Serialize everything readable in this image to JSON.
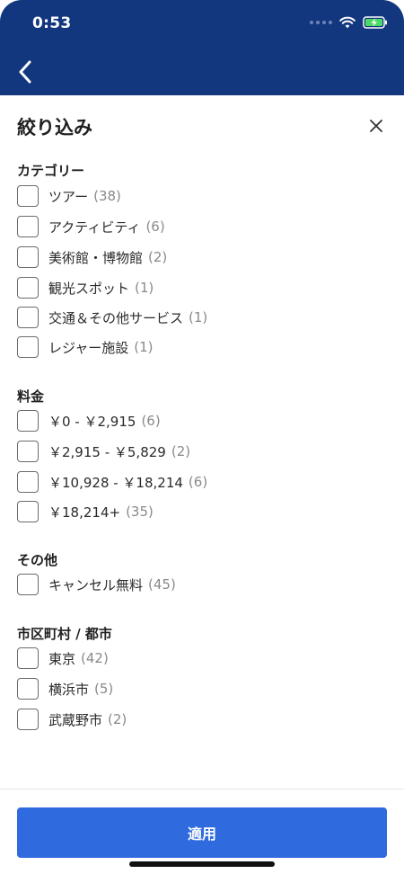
{
  "status_bar": {
    "time": "0:53"
  },
  "header": {
    "back_icon": "chevron-left-icon"
  },
  "panel": {
    "title": "絞り込み",
    "close_icon": "close-icon"
  },
  "sections": [
    {
      "title": "カテゴリー",
      "options": [
        {
          "label": "ツアー",
          "count": "(38)",
          "checked": false
        },
        {
          "label": "アクティビティ",
          "count": "(6)",
          "checked": false
        },
        {
          "label": "美術館・博物館",
          "count": "(2)",
          "checked": false
        },
        {
          "label": "観光スポット",
          "count": "(1)",
          "checked": false
        },
        {
          "label": "交通＆その他サービス",
          "count": "(1)",
          "checked": false
        },
        {
          "label": "レジャー施設",
          "count": "(1)",
          "checked": false
        }
      ]
    },
    {
      "title": "料金",
      "options": [
        {
          "label": "￥0 - ￥2,915",
          "count": "(6)",
          "checked": false
        },
        {
          "label": "￥2,915 - ￥5,829",
          "count": "(2)",
          "checked": false
        },
        {
          "label": "￥10,928 - ￥18,214",
          "count": "(6)",
          "checked": false
        },
        {
          "label": "￥18,214+",
          "count": "(35)",
          "checked": false
        }
      ]
    },
    {
      "title": "その他",
      "options": [
        {
          "label": "キャンセル無料",
          "count": "(45)",
          "checked": false
        }
      ]
    },
    {
      "title": "市区町村 / 都市",
      "options": [
        {
          "label": "東京",
          "count": "(42)",
          "checked": false
        },
        {
          "label": "横浜市",
          "count": "(5)",
          "checked": false
        },
        {
          "label": "武蔵野市",
          "count": "(2)",
          "checked": false
        }
      ]
    }
  ],
  "footer": {
    "apply_label": "適用"
  },
  "colors": {
    "header": "#13377f",
    "primary": "#2f6ade"
  }
}
